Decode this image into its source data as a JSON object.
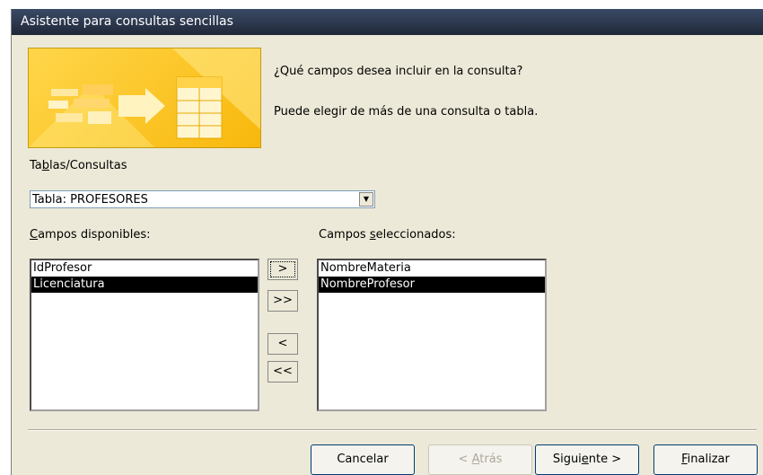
{
  "window": {
    "title": "Asistente para consultas sencillas"
  },
  "prompt": {
    "question": "¿Qué campos desea incluir en la consulta?",
    "hint": "Puede elegir de más de una consulta o tabla."
  },
  "source": {
    "label_pre": "Ta",
    "label_key": "b",
    "label_post": "las/Consultas",
    "selected": "Tabla: PROFESORES"
  },
  "available": {
    "label_key": "C",
    "label_post": "ampos disponibles:",
    "items": [
      {
        "label": "IdProfesor",
        "selected": false
      },
      {
        "label": "Licenciatura",
        "selected": true
      }
    ]
  },
  "selected_fields": {
    "label_pre": "Campos ",
    "label_key": "s",
    "label_post": "eleccionados:",
    "items": [
      {
        "label": "NombreMateria",
        "selected": false
      },
      {
        "label": "NombreProfesor",
        "selected": true
      }
    ]
  },
  "move_buttons": {
    "add_one": ">",
    "add_all": ">>",
    "remove_one": "<",
    "remove_all": "<<"
  },
  "footer": {
    "cancel": "Cancelar",
    "back_pre": "< ",
    "back_key": "A",
    "back_post": "trás",
    "next_pre": "Sigui",
    "next_key": "e",
    "next_post": "nte >",
    "finish_key": "F",
    "finish_post": "inalizar"
  }
}
